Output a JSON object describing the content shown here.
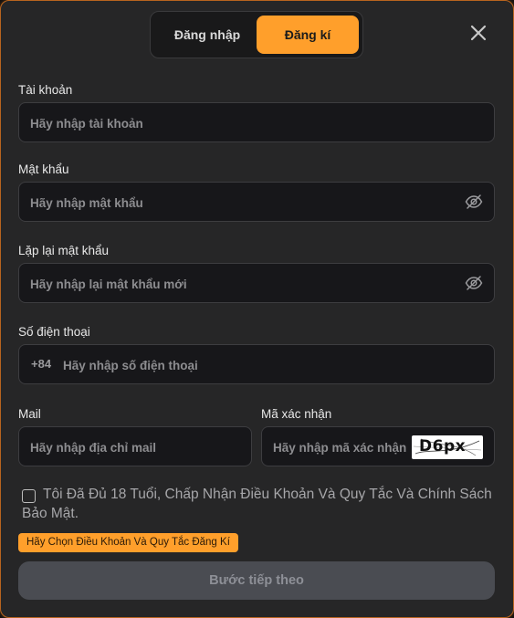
{
  "tabs": {
    "login": "Đăng nhập",
    "register": "Đăng kí"
  },
  "form": {
    "account": {
      "label": "Tài khoản",
      "placeholder": "Hãy nhập tài khoản"
    },
    "password": {
      "label": "Mật khẩu",
      "placeholder": "Hãy nhập mật khẩu"
    },
    "confirm_password": {
      "label": "Lặp lại mật khẩu",
      "placeholder": "Hãy nhập lại mật khẩu mới"
    },
    "phone": {
      "label": "Số điện thoại",
      "prefix": "+84",
      "placeholder": "Hãy nhập số điện thoại"
    },
    "mail": {
      "label": "Mail",
      "placeholder": "Hãy nhập địa chỉ mail"
    },
    "captcha": {
      "label": "Mã xác nhận",
      "placeholder": "Hãy nhập mã xác nhận",
      "code": "D6px"
    }
  },
  "terms": {
    "text": "Tôi Đã Đủ 18 Tuổi, Chấp Nhận Điều Khoản Và Quy Tắc Và Chính Sách Bảo Mật.",
    "warning": "Hãy Chọn Điều Khoản Và Quy Tắc Đăng Kí"
  },
  "submit_label": "Bước tiếp theo",
  "colors": {
    "accent": "#ff9f2b",
    "background": "#262627",
    "field": "#17171a",
    "button_disabled": "#4a4c52"
  },
  "icons": {
    "close": "close-icon",
    "eye": "eye-off-icon"
  }
}
